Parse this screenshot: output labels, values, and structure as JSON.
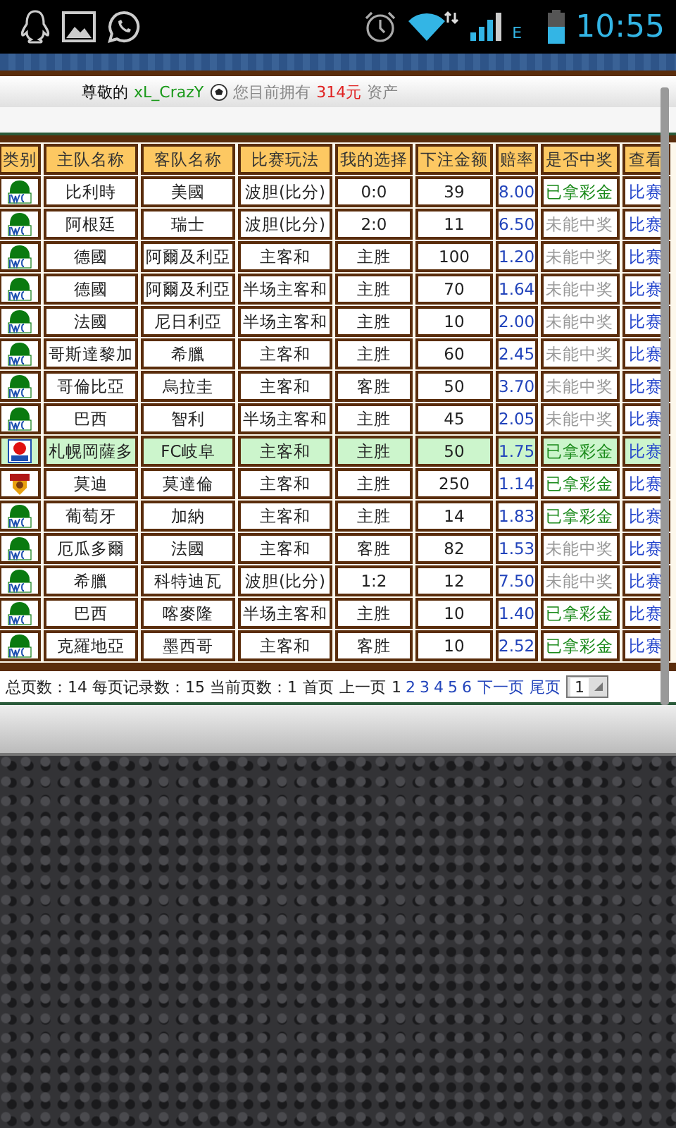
{
  "status_bar": {
    "network": "E",
    "time": "10:55"
  },
  "welcome": {
    "greeting": "尊敬的",
    "username": "xL_CrazY",
    "assets_label": "您目前拥有",
    "amount": "314元",
    "assets_suffix": "资产"
  },
  "table": {
    "columns": [
      "类别",
      "主队名称",
      "客队名称",
      "比赛玩法",
      "我的选择",
      "下注金额",
      "赔率",
      "是否中奖",
      "查看"
    ],
    "rows": [
      {
        "kind": "wc",
        "home": "比利時",
        "away": "美國",
        "bet_type": "波胆(比分)",
        "choice": "0:0",
        "stake": "39",
        "odds": "8.00",
        "won": true,
        "result": "已拿彩金",
        "link": "比赛",
        "selected": false
      },
      {
        "kind": "wc",
        "home": "阿根廷",
        "away": "瑞士",
        "bet_type": "波胆(比分)",
        "choice": "2:0",
        "stake": "11",
        "odds": "6.50",
        "won": false,
        "result": "未能中奖",
        "link": "比赛",
        "selected": false
      },
      {
        "kind": "wc",
        "home": "德國",
        "away": "阿爾及利亞",
        "bet_type": "主客和",
        "choice": "主胜",
        "stake": "100",
        "odds": "1.20",
        "won": false,
        "result": "未能中奖",
        "link": "比赛",
        "selected": false
      },
      {
        "kind": "wc",
        "home": "德國",
        "away": "阿爾及利亞",
        "bet_type": "半场主客和",
        "choice": "主胜",
        "stake": "70",
        "odds": "1.64",
        "won": false,
        "result": "未能中奖",
        "link": "比赛",
        "selected": false
      },
      {
        "kind": "wc",
        "home": "法國",
        "away": "尼日利亞",
        "bet_type": "半场主客和",
        "choice": "主胜",
        "stake": "10",
        "odds": "2.00",
        "won": false,
        "result": "未能中奖",
        "link": "比赛",
        "selected": false
      },
      {
        "kind": "wc",
        "home": "哥斯達黎加",
        "away": "希臘",
        "bet_type": "主客和",
        "choice": "主胜",
        "stake": "60",
        "odds": "2.45",
        "won": false,
        "result": "未能中奖",
        "link": "比赛",
        "selected": false
      },
      {
        "kind": "wc",
        "home": "哥倫比亞",
        "away": "烏拉圭",
        "bet_type": "主客和",
        "choice": "客胜",
        "stake": "50",
        "odds": "3.70",
        "won": false,
        "result": "未能中奖",
        "link": "比赛",
        "selected": false
      },
      {
        "kind": "wc",
        "home": "巴西",
        "away": "智利",
        "bet_type": "半场主客和",
        "choice": "主胜",
        "stake": "45",
        "odds": "2.05",
        "won": false,
        "result": "未能中奖",
        "link": "比赛",
        "selected": false
      },
      {
        "kind": "j2",
        "home": "札幌岡薩多",
        "away": "FC岐阜",
        "bet_type": "主客和",
        "choice": "主胜",
        "stake": "50",
        "odds": "1.75",
        "won": true,
        "result": "已拿彩金",
        "link": "比赛",
        "selected": true
      },
      {
        "kind": "club",
        "home": "莫迪",
        "away": "莫達倫",
        "bet_type": "主客和",
        "choice": "主胜",
        "stake": "250",
        "odds": "1.14",
        "won": true,
        "result": "已拿彩金",
        "link": "比赛",
        "selected": false
      },
      {
        "kind": "wc",
        "home": "葡萄牙",
        "away": "加納",
        "bet_type": "主客和",
        "choice": "主胜",
        "stake": "14",
        "odds": "1.83",
        "won": true,
        "result": "已拿彩金",
        "link": "比赛",
        "selected": false
      },
      {
        "kind": "wc",
        "home": "厄瓜多爾",
        "away": "法國",
        "bet_type": "主客和",
        "choice": "客胜",
        "stake": "82",
        "odds": "1.53",
        "won": false,
        "result": "未能中奖",
        "link": "比赛",
        "selected": false
      },
      {
        "kind": "wc",
        "home": "希臘",
        "away": "科特迪瓦",
        "bet_type": "波胆(比分)",
        "choice": "1:2",
        "stake": "12",
        "odds": "7.50",
        "won": false,
        "result": "未能中奖",
        "link": "比赛",
        "selected": false
      },
      {
        "kind": "wc",
        "home": "巴西",
        "away": "喀麥隆",
        "bet_type": "半场主客和",
        "choice": "主胜",
        "stake": "10",
        "odds": "1.40",
        "won": true,
        "result": "已拿彩金",
        "link": "比赛",
        "selected": false
      },
      {
        "kind": "wc",
        "home": "克羅地亞",
        "away": "墨西哥",
        "bet_type": "主客和",
        "choice": "客胜",
        "stake": "10",
        "odds": "2.52",
        "won": true,
        "result": "已拿彩金",
        "link": "比赛",
        "selected": false
      }
    ]
  },
  "pagination": {
    "summary": "总页数：14 每页记录数：15 当前页数：1",
    "first": "首页",
    "prev": "上一页",
    "pages": [
      {
        "label": "1",
        "selected": true
      },
      {
        "label": "2",
        "selected": false
      },
      {
        "label": "3",
        "selected": false
      },
      {
        "label": "4",
        "selected": false
      },
      {
        "label": "5",
        "selected": false
      },
      {
        "label": "6",
        "selected": false
      }
    ],
    "next": "下一页",
    "last": "尾页",
    "jump_value": "1"
  }
}
